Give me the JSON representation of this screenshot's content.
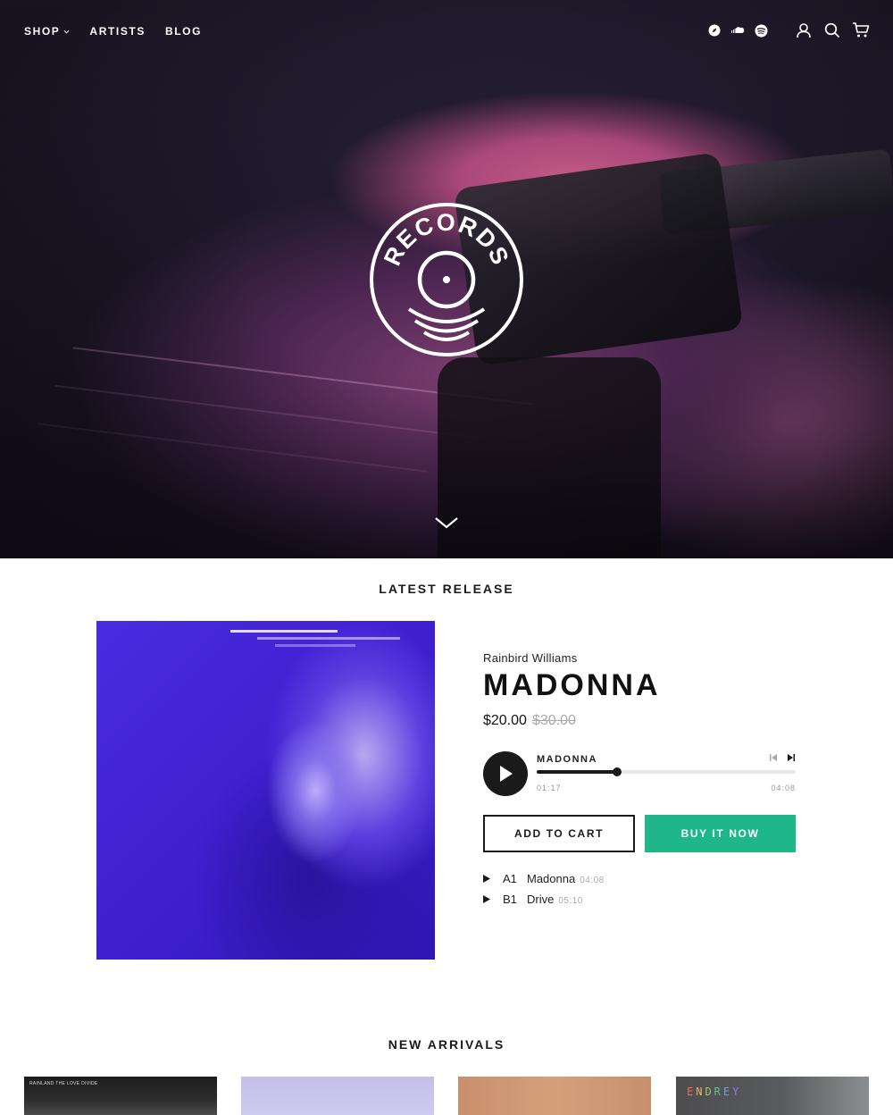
{
  "nav": {
    "links": [
      {
        "label": "SHOP",
        "has_dropdown": true
      },
      {
        "label": "ARTISTS"
      },
      {
        "label": "BLOG"
      }
    ],
    "social_icons": [
      "compass-icon",
      "soundcloud-icon",
      "spotify-icon"
    ],
    "utility_icons": [
      "account-icon",
      "search-icon",
      "cart-icon"
    ]
  },
  "hero": {
    "logo_text": "RECORDS"
  },
  "latest_release": {
    "heading": "LATEST RELEASE",
    "artist": "Rainbird Williams",
    "title": "MADONNA",
    "price": "$20.00",
    "compare_price": "$30.00",
    "player": {
      "track": "MADONNA",
      "current_time": "01:17",
      "duration": "04:08",
      "progress_fraction": 0.31
    },
    "add_to_cart": "ADD TO CART",
    "buy_now": "BUY IT NOW",
    "tracks": [
      {
        "side": "A1",
        "name": "Madonna",
        "duration": "04:08"
      },
      {
        "side": "B1",
        "name": "Drive",
        "duration": "05:10"
      }
    ]
  },
  "new_arrivals": {
    "heading": "NEW ARRIVALS",
    "tile_texts": {
      "tile1": "RAINLAND  THE LOVE DIVIDE",
      "tile4": "ENDREY"
    }
  },
  "colors": {
    "accent_green": "#1fb68a",
    "text_dark": "#1a1a1a",
    "cover_purple": "#4a2ce0"
  }
}
